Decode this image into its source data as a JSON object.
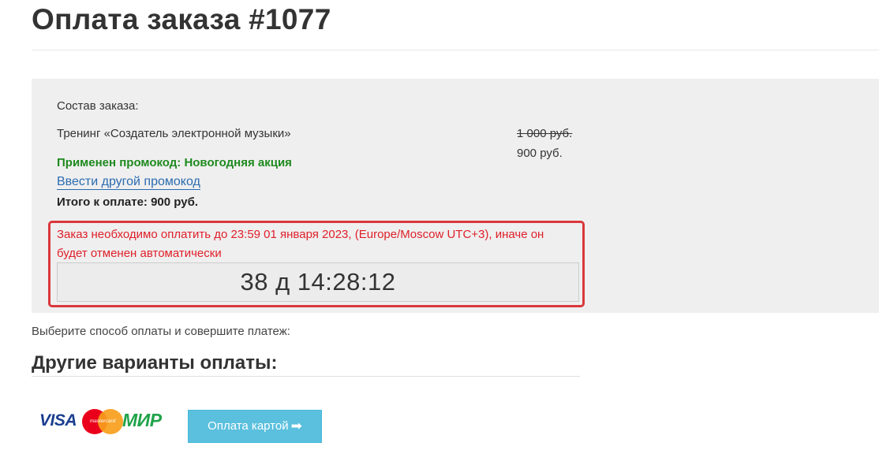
{
  "page": {
    "title": "Оплата заказа #1077"
  },
  "order": {
    "heading": "Состав заказа:",
    "item_name": "Тренинг «Создатель электронной музыки»",
    "old_price": "1 000 руб.",
    "new_price": "900 руб.",
    "promo_applied": "Применен промокод: Новогодняя акция",
    "promo_link": "Ввести другой промокод",
    "total": "Итого к оплате: 900 руб."
  },
  "deadline": {
    "message": "Заказ необходимо оплатить до 23:59 01 января 2023, (Europe/Moscow UTC+3), иначе он будет отменен автоматически",
    "countdown": "38 д 14:28:12"
  },
  "payment": {
    "instructions": "Выберите способ оплаты и совершите платеж:",
    "other_methods_heading": "Другие варианты оплаты:",
    "logos": {
      "visa": "VISA",
      "mastercard": "mastercard",
      "mir": "МИР"
    },
    "card_button_label": "Оплата картой",
    "card_button_icon": "arrow-right-icon"
  },
  "colors": {
    "accent_button": "#5bc0de",
    "promo_green": "#1e8a1e",
    "warning_red": "#e0202a",
    "link_blue": "#2a6bb0"
  }
}
